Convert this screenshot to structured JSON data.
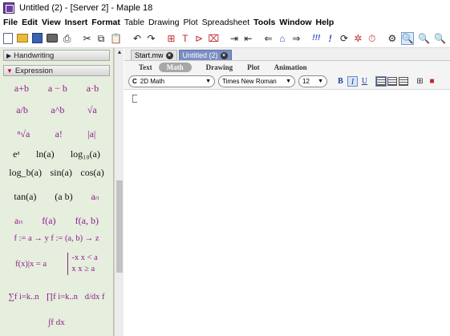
{
  "window": {
    "title": "Untitled (2) - [Server 2] - Maple 18"
  },
  "menu": [
    {
      "label": "File",
      "bold": true
    },
    {
      "label": "Edit",
      "bold": true
    },
    {
      "label": "View",
      "bold": true
    },
    {
      "label": "Insert",
      "bold": true
    },
    {
      "label": "Format",
      "bold": true
    },
    {
      "label": "Table",
      "bold": false
    },
    {
      "label": "Drawing",
      "bold": false
    },
    {
      "label": "Plot",
      "bold": false
    },
    {
      "label": "Spreadsheet",
      "bold": false
    },
    {
      "label": "Tools",
      "bold": true
    },
    {
      "label": "Window",
      "bold": true
    },
    {
      "label": "Help",
      "bold": true
    }
  ],
  "toolbar": {
    "text_tool_glyph": "T",
    "exec_glyph": "!!!",
    "exec_one_glyph": "!"
  },
  "palettes": {
    "handwriting": "Handwriting",
    "expression": "Expression",
    "items": {
      "r1": [
        "a+b",
        "a − b",
        "a·b"
      ],
      "r2": [
        "a/b",
        "a^b",
        "√a"
      ],
      "r3": [
        "ⁿ√a",
        "a!",
        "|a|"
      ],
      "r4": [
        "eᵃ",
        "ln(a)",
        "log₁₀(a)"
      ],
      "r5": [
        "log_b(a)",
        "sin(a)",
        "cos(a)"
      ],
      "r6": [
        "tan(a)",
        "(a b)",
        "aₙ"
      ],
      "r7": [
        "aₙ",
        "f(a)",
        "f(a, b)"
      ],
      "r8": "f := a → y  f := (a, b) → z",
      "r9_left": "f(x)|x = a",
      "r9_right_top": "-x  x < a",
      "r9_right_bottom": "x  x ≥ a",
      "r10": [
        "∑f  i=k..n",
        "∏f  i=k..n",
        "d/dx f"
      ],
      "r11": "∫f dx"
    }
  },
  "document": {
    "tabs": [
      {
        "label": "Start.mw",
        "active": false
      },
      {
        "label": "Untitled (2)",
        "active": true
      }
    ],
    "modes": [
      "Text",
      "Math",
      "Drawing",
      "Plot",
      "Animation"
    ],
    "active_mode": "Math",
    "format": {
      "style": "2D Math",
      "style_prefix": "C",
      "font": "Times New Roman",
      "size": "12",
      "bold": "B",
      "italic": "I",
      "underline": "U"
    }
  }
}
